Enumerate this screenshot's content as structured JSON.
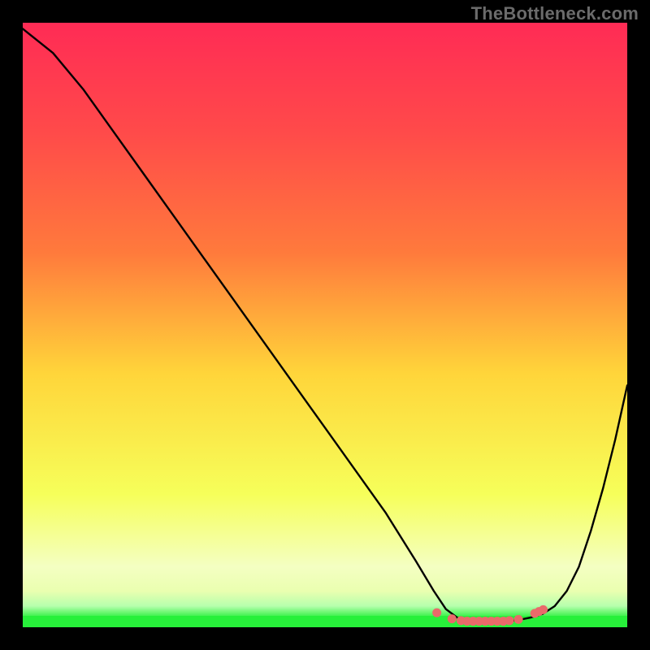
{
  "watermark": "TheBottleneck.com",
  "colors": {
    "bg": "#000000",
    "curve": "#000000",
    "dots": "#e96a6a",
    "optimal_band": "#27f03a",
    "grad_top": "#ff2b55",
    "grad_mid1": "#ff7a3c",
    "grad_mid2": "#ffd53a",
    "grad_low": "#f6ff5a",
    "grad_bottom_pale": "#eaffb0"
  },
  "chart_data": {
    "type": "line",
    "title": "",
    "xlabel": "",
    "ylabel": "",
    "xlim": [
      0,
      100
    ],
    "ylim": [
      0,
      100
    ],
    "x": [
      0,
      5,
      10,
      15,
      20,
      25,
      30,
      35,
      40,
      45,
      50,
      55,
      60,
      65,
      68,
      70,
      72,
      74,
      76,
      78,
      80,
      82,
      84,
      86,
      88,
      90,
      92,
      94,
      96,
      98,
      100
    ],
    "values": [
      99,
      95,
      89,
      82,
      75,
      68,
      61,
      54,
      47,
      40,
      33,
      26,
      19,
      11,
      6,
      3,
      1.5,
      1,
      1,
      1,
      1,
      1.2,
      1.6,
      2.2,
      3.5,
      6,
      10,
      16,
      23,
      31,
      40
    ],
    "optimal_range_x": [
      68,
      87
    ],
    "dot_x": [
      68.5,
      71.0,
      72.5,
      73.5,
      74.5,
      75.5,
      76.5,
      77.5,
      78.5,
      79.5,
      80.5,
      82.0,
      84.7,
      85.4,
      86.1
    ],
    "dot_y": [
      2.4,
      1.4,
      1.1,
      1.0,
      1.0,
      1.0,
      1.0,
      1.0,
      1.0,
      1.0,
      1.1,
      1.3,
      2.3,
      2.6,
      2.9
    ]
  }
}
